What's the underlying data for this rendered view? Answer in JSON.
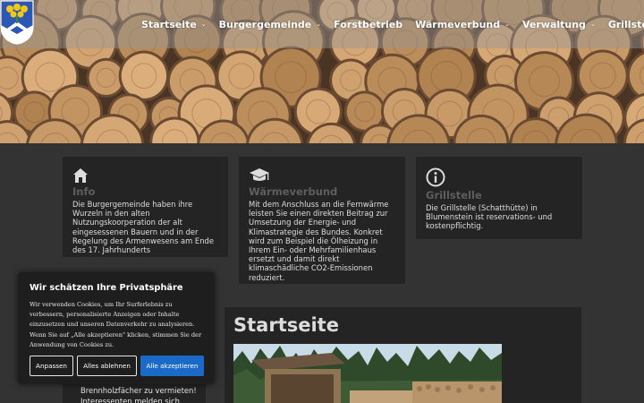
{
  "nav": {
    "items": [
      {
        "label": "Startseite",
        "has_dropdown": true
      },
      {
        "label": "Burgergemeinde",
        "has_dropdown": true
      },
      {
        "label": "Forstbetrieb",
        "has_dropdown": false
      },
      {
        "label": "Wärmeverbund",
        "has_dropdown": true
      },
      {
        "label": "Verwaltung",
        "has_dropdown": true
      },
      {
        "label": "Grillstelle",
        "has_dropdown": false
      }
    ],
    "dropdown_glyph": "⌄"
  },
  "cards": [
    {
      "icon": "home-icon",
      "title": "Info",
      "text": "Die Burgergemeinde haben ihre Wurzeln in den alten Nutzungskoorperation der alt eingesessenen Bauern und in der Regelung des Armenwesens am Ende des 17. Jahrhunderts"
    },
    {
      "icon": "graduation-cap-icon",
      "title": "Wärmeverbund",
      "text": "Mit dem Anschluss an die Fernwärme leisten Sie einen direkten Beitrag zur Umsetzung der Energie- und Klimastrategie des Bundes. Konkret wird zum Beispiel die Ölheizung in Ihrem Ein- oder Mehrfamilienhaus ersetzt und damit direkt klimaschädliche CO2-Emissionen reduziert."
    },
    {
      "icon": "info-icon",
      "title": "Grillstelle",
      "text": "Die Grillstelle (Schatthütte) in Blumenstein ist reservations- und kostenpflichtig."
    }
  ],
  "main": {
    "title": "Startseite"
  },
  "sidebar": {
    "text": "Brennholzfächer zu vermieten! Interessenten melden sich"
  },
  "cookie": {
    "title": "Wir schätzen Ihre Privatsphäre",
    "text": "Wir verwenden Cookies, um Ihr Surferlebnis zu verbessern, personalisierte Anzeigen oder Inhalte einzusetzen und unseren Datenverkehr zu analysieren. Wenn Sie auf „Alle akzeptieren\" klicken, stimmen Sie der Anwendung von Cookies zu.",
    "customize_label": "Anpassen",
    "reject_label": "Alles ablehnen",
    "accept_label": "Alle akzeptieren"
  },
  "colors": {
    "background": "#333333",
    "card": "#242424",
    "accent": "#1c6ac7",
    "heading_muted": "#5e5e5e"
  }
}
